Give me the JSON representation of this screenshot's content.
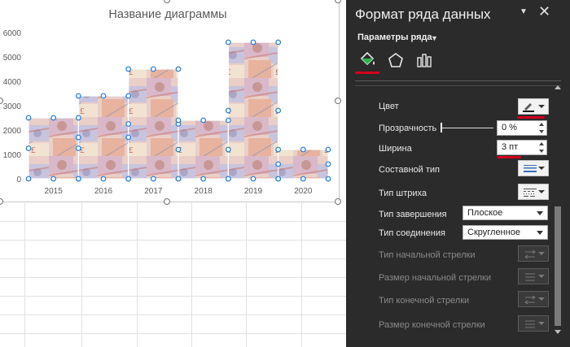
{
  "chart_data": {
    "type": "bar",
    "title": "Название диаграммы",
    "categories": [
      "2015",
      "2016",
      "2017",
      "2018",
      "2019",
      "2020"
    ],
    "values": [
      2500,
      3400,
      4500,
      2400,
      5600,
      1200
    ],
    "ylim": [
      0,
      6000
    ],
    "yticks": [
      "0",
      "1000",
      "2000",
      "3000",
      "4000",
      "5000",
      "6000"
    ],
    "grid": false,
    "fill": "banknote picture fill"
  },
  "pane": {
    "title": "Формат ряда данных",
    "section": "Параметры ряда",
    "tabs": [
      "fill-line-icon",
      "effects-icon",
      "series-options-icon"
    ],
    "rows": {
      "color": "Цвет",
      "transparency": "Прозрачность",
      "transparency_value": "0 %",
      "transparency_level": 0,
      "width": "Ширина",
      "width_value": "3 пт",
      "compound": "Составной тип",
      "dash": "Тип штриха",
      "cap": "Тип завершения",
      "cap_value": "Плоское",
      "join": "Тип соединения",
      "join_value": "Скругленное",
      "begin_arrow_type": "Тип начальной стрелки",
      "begin_arrow_size": "Размер начальной стрелки",
      "end_arrow_type": "Тип конечной стрелки",
      "end_arrow_size": "Размер конечной стрелки"
    }
  },
  "colors": {
    "pane_bg": "#2b2b2b",
    "accent_red": "#d2001f",
    "selection_handle": "#1f7ad8",
    "fill_icon_green": "#2bb24c"
  }
}
